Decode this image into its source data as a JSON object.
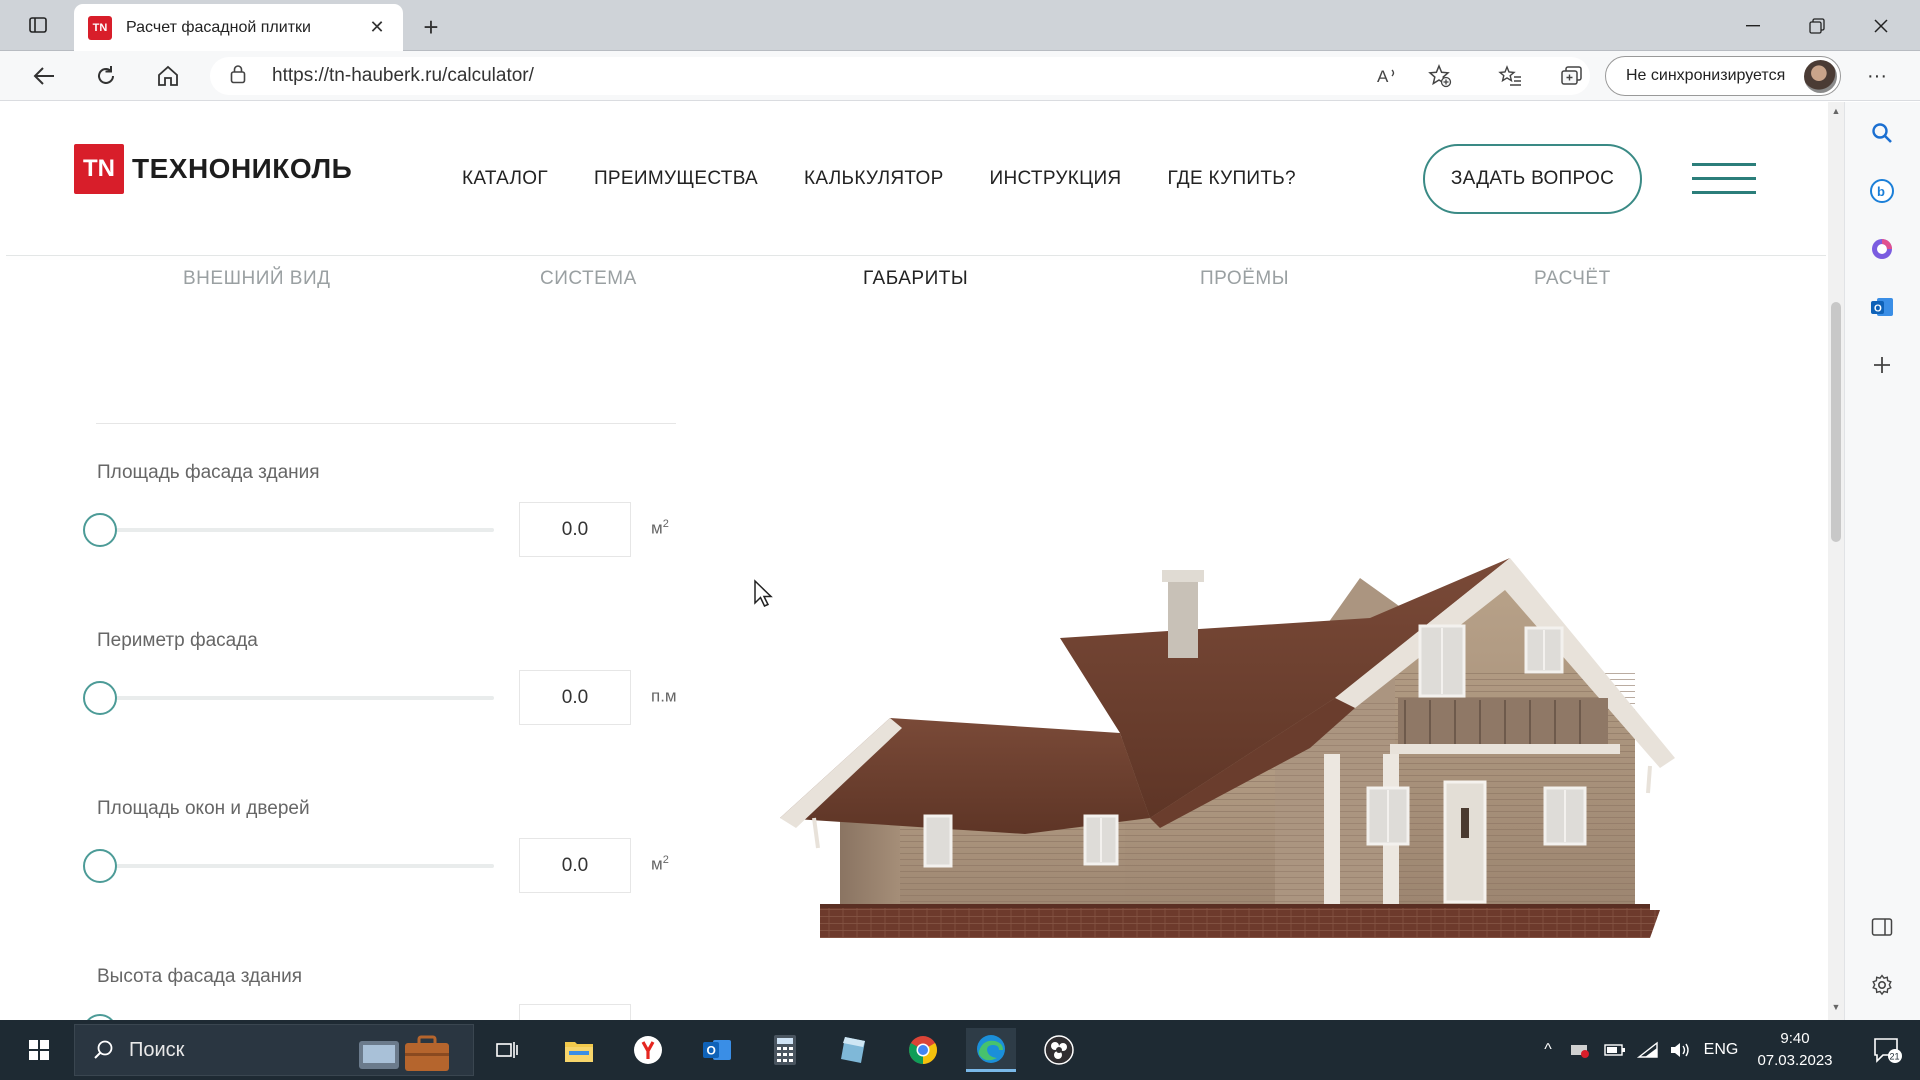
{
  "browser": {
    "tab_title": "Расчет фасадной плитки",
    "tab_favicon": "TN",
    "url": "https://tn-hauberk.ru/calculator/",
    "profile_label": "Не синхронизируется"
  },
  "site": {
    "logo_mark": "TN",
    "logo_text": "ТЕХНОНИКОЛЬ",
    "nav": [
      "КАТАЛОГ",
      "ПРЕИМУЩЕСТВА",
      "КАЛЬКУЛЯТОР",
      "ИНСТРУКЦИЯ",
      "ГДЕ КУПИТЬ?"
    ],
    "ask_button": "ЗАДАТЬ ВОПРОС",
    "accent_color": "#3a8a85",
    "brand_color": "#d81e2a"
  },
  "steps": [
    {
      "label": "ВНЕШНИЙ ВИД",
      "active": false
    },
    {
      "label": "СИСТЕМА",
      "active": false
    },
    {
      "label": "ГАБАРИТЫ",
      "active": true
    },
    {
      "label": "ПРОЁМЫ",
      "active": false
    },
    {
      "label": "РАСЧЁТ",
      "active": false
    }
  ],
  "fields": [
    {
      "label": "Площадь фасада здания",
      "value": "0.0",
      "unit": "м",
      "unit_sup": "2",
      "slider_fraction": 0
    },
    {
      "label": "Периметр фасада",
      "value": "0.0",
      "unit": "п.м",
      "unit_sup": "",
      "slider_fraction": 0
    },
    {
      "label": "Площадь окон и дверей",
      "value": "0.0",
      "unit": "м",
      "unit_sup": "2",
      "slider_fraction": 0
    },
    {
      "label": "Высота фасада здания",
      "value": "",
      "unit": "",
      "unit_sup": "",
      "slider_fraction": 0
    }
  ],
  "taskbar": {
    "search_placeholder": "Поиск",
    "language": "ENG",
    "time": "9:40",
    "date": "07.03.2023",
    "notification_count": "21"
  }
}
